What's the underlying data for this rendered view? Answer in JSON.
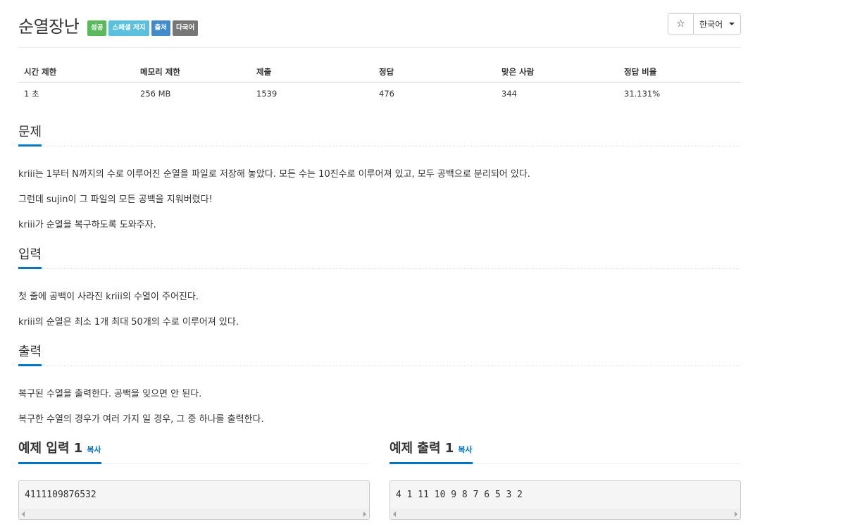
{
  "problem": {
    "title": "순열장난",
    "labels": [
      {
        "text": "성공",
        "color": "#5cb85c"
      },
      {
        "text": "스페셜 저지",
        "color": "#5bc0de"
      },
      {
        "text": "출처",
        "color": "#428bca"
      },
      {
        "text": "다국어",
        "color": "#777777"
      }
    ],
    "star_icon": "☆",
    "language": "한국어"
  },
  "info": {
    "headers": [
      "시간 제한",
      "메모리 제한",
      "제출",
      "정답",
      "맞은 사람",
      "정답 비율"
    ],
    "values": [
      "1 초",
      "256 MB",
      "1539",
      "476",
      "344",
      "31.131%"
    ]
  },
  "sections": {
    "description": {
      "title": "문제",
      "paragraphs": [
        "kriii는 1부터 N까지의 수로 이루어진 순열을 파일로 저장해 놓았다. 모든 수는 10진수로 이루어져 있고, 모두 공백으로 분리되어 있다.",
        "그런데 sujin이 그 파일의 모든 공백을 지워버렸다!",
        "kriii가 순열을 복구하도록 도와주자."
      ]
    },
    "input": {
      "title": "입력",
      "paragraphs": [
        "첫 줄에 공백이 사라진 kriii의 수열이 주어진다.",
        "kriii의 순열은 최소 1개 최대 50개의 수로 이루어져 있다."
      ]
    },
    "output": {
      "title": "출력",
      "paragraphs": [
        "복구된 수열을 출력한다. 공백을 잊으면 안 된다.",
        "복구한 수열의 경우가 여러 가지 일 경우, 그 중 하나를 출력한다."
      ]
    }
  },
  "samples": {
    "input": {
      "title": "예제 입력 1",
      "copy_label": "복사",
      "content": "4111109876532"
    },
    "output": {
      "title": "예제 출력 1",
      "copy_label": "복사",
      "content": "4 1 11 10 9 8 7 6 5 3 2"
    }
  }
}
